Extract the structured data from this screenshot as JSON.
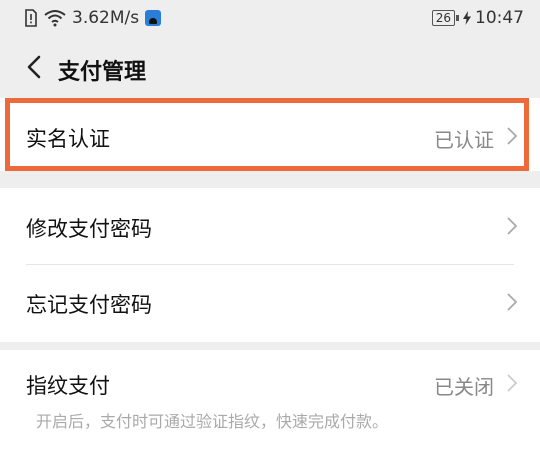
{
  "status_bar": {
    "speed": "3.62M/s",
    "battery": "26",
    "time": "10:47"
  },
  "header": {
    "title": "支付管理"
  },
  "rows": {
    "real_name": {
      "label": "实名认证",
      "value": "已认证"
    },
    "change_password": {
      "label": "修改支付密码"
    },
    "forgot_password": {
      "label": "忘记支付密码"
    },
    "fingerprint": {
      "label": "指纹支付",
      "value": "已关闭",
      "hint": "开启后，支付时可通过验证指纹，快速完成付款。"
    }
  },
  "colors": {
    "highlight": "#ef6a3a",
    "background": "#eeeeee",
    "card": "#ffffff"
  },
  "icons": [
    "sim-alert-icon",
    "wifi-icon",
    "app-notification-icon",
    "battery-icon",
    "charging-icon",
    "back-arrow-icon",
    "chevron-right-icon"
  ]
}
